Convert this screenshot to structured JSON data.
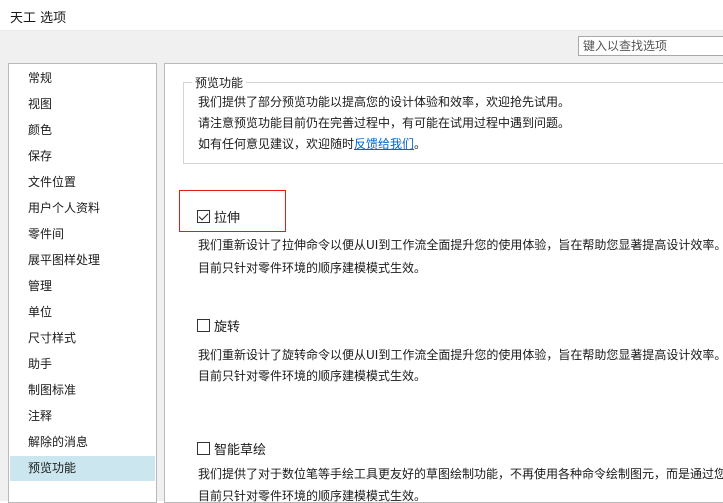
{
  "window": {
    "title": "天工 选项"
  },
  "search": {
    "placeholder": "键入以查找选项"
  },
  "sidebar": {
    "items": [
      {
        "label": "常规"
      },
      {
        "label": "视图"
      },
      {
        "label": "颜色"
      },
      {
        "label": "保存"
      },
      {
        "label": "文件位置"
      },
      {
        "label": "用户个人资料"
      },
      {
        "label": "零件间"
      },
      {
        "label": "展平图样处理"
      },
      {
        "label": "管理"
      },
      {
        "label": "单位"
      },
      {
        "label": "尺寸样式"
      },
      {
        "label": "助手"
      },
      {
        "label": "制图标准"
      },
      {
        "label": "注释"
      },
      {
        "label": "解除的消息"
      },
      {
        "label": "预览功能",
        "selected": true
      }
    ]
  },
  "preview": {
    "heading": "预览功能",
    "line1": "我们提供了部分预览功能以提高您的设计体验和效率，欢迎抢先试用。",
    "line2": "请注意预览功能目前仍在完善过程中，有可能在试用过程中遇到问题。",
    "line3_prefix": "如有任何意见建议，欢迎随时",
    "feedback_link": "反馈给我们",
    "line3_suffix": "。"
  },
  "features": [
    {
      "label": "拉伸",
      "checked": true,
      "desc1": "我们重新设计了拉伸命令以便从UI到工作流全面提升您的使用体验，旨在帮助您显著提高设计效率。",
      "desc2": "目前只针对零件环境的顺序建模模式生效。"
    },
    {
      "label": "旋转",
      "checked": false,
      "desc1": "我们重新设计了旋转命令以便从UI到工作流全面提升您的使用体验，旨在帮助您显著提高设计效率。",
      "desc2": "目前只针对零件环境的顺序建模模式生效。"
    },
    {
      "label": "智能草绘",
      "checked": false,
      "desc1": "我们提供了对于数位笔等手绘工具更友好的草图绘制功能，不再使用各种命令绘制图元，而是通过您",
      "desc2": "目前只针对零件环境的顺序建模模式生效。"
    }
  ],
  "colors": {
    "selected_bg": "#cbe6ef",
    "highlight_border": "#e31b1b",
    "link": "#0066cc"
  }
}
